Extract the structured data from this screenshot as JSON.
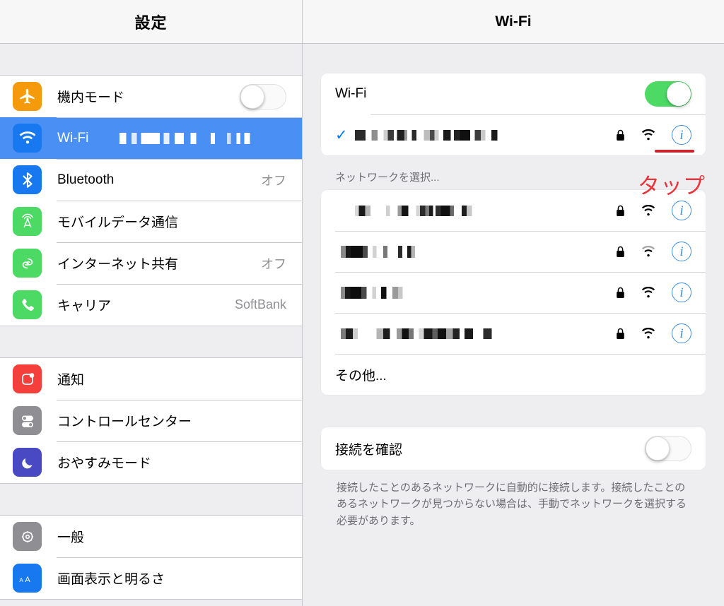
{
  "left": {
    "title": "設定",
    "groups": [
      {
        "items": [
          {
            "label": "機内モード",
            "icon": "airplane-icon",
            "color": "#f59a0b",
            "control": "toggle",
            "toggle_on": false
          },
          {
            "label": "Wi-Fi",
            "icon": "wifi-icon",
            "color": "#1878f0",
            "selected": true,
            "value_redacted": true
          },
          {
            "label": "Bluetooth",
            "icon": "bluetooth-icon",
            "color": "#1878f0",
            "value": "オフ"
          },
          {
            "label": "モバイルデータ通信",
            "icon": "cellular-icon",
            "color": "#4cd964",
            "value": ""
          },
          {
            "label": "インターネット共有",
            "icon": "hotspot-icon",
            "color": "#4cd964",
            "value": "オフ"
          },
          {
            "label": "キャリア",
            "icon": "phone-icon",
            "color": "#4cd964",
            "value": "SoftBank"
          }
        ]
      },
      {
        "items": [
          {
            "label": "通知",
            "icon": "notifications-icon",
            "color": "#f43f3b",
            "value": ""
          },
          {
            "label": "コントロールセンター",
            "icon": "control-center-icon",
            "color": "#8e8e93",
            "value": ""
          },
          {
            "label": "おやすみモード",
            "icon": "moon-icon",
            "color": "#4a49c4",
            "value": ""
          }
        ]
      },
      {
        "items": [
          {
            "label": "一般",
            "icon": "gear-icon",
            "color": "#8e8e93",
            "value": ""
          },
          {
            "label": "画面表示と明るさ",
            "icon": "display-brightness-icon",
            "color": "#1878f0",
            "value": ""
          }
        ]
      }
    ]
  },
  "right": {
    "title": "Wi-Fi",
    "wifi_toggle_label": "Wi-Fi",
    "wifi_toggle_on": true,
    "connected_network": {
      "ssid": "",
      "ssid_redacted": true,
      "checked": true,
      "secure": true,
      "signal": 3,
      "info_label": "i"
    },
    "choose_network_header": "ネットワークを選択...",
    "networks": [
      {
        "ssid": "",
        "ssid_redacted": true,
        "secure": true,
        "signal": 3,
        "info_label": "i"
      },
      {
        "ssid": "",
        "ssid_redacted": true,
        "secure": true,
        "signal": 2,
        "info_label": "i"
      },
      {
        "ssid": "",
        "ssid_redacted": true,
        "secure": true,
        "signal": 3,
        "info_label": "i"
      },
      {
        "ssid": "",
        "ssid_redacted": true,
        "secure": true,
        "signal": 3,
        "info_label": "i"
      }
    ],
    "other_label": "その他...",
    "ask_to_join_label": "接続を確認",
    "ask_to_join_on": false,
    "footer_note": "接続したことのあるネットワークに自動的に接続します。接続したことのあるネットワークが見つからない場合は、手動でネットワークを選択する必要があります。"
  },
  "annotations": {
    "tap_label": "タップ",
    "tap_color": "#e8353b",
    "underline_color": "#c9252d"
  }
}
